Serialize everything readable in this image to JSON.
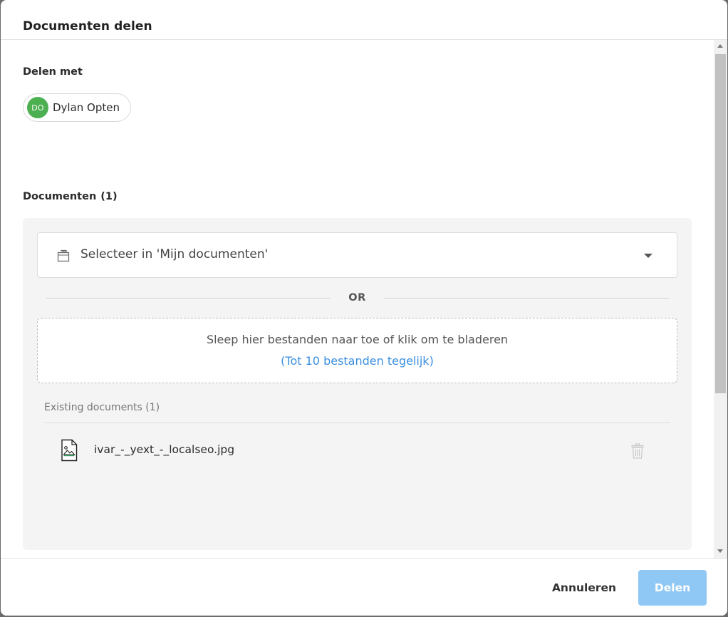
{
  "dialog": {
    "title": "Documenten delen"
  },
  "share_with": {
    "label": "Delen met",
    "recipients": [
      {
        "initials": "DO",
        "name": "Dylan Opten",
        "color": "#4caf50"
      }
    ]
  },
  "documents": {
    "label": "Documenten",
    "count": "(1)",
    "select": {
      "text": "Selecteer in 'Mijn documenten'",
      "icon": "folder-icon"
    },
    "divider_text": "OR",
    "dropzone": {
      "main_text": "Sleep hier bestanden naar toe of klik om te bladeren",
      "sub_text": "(Tot 10 bestanden tegelijk)"
    },
    "existing": {
      "title": "Existing documents (1)",
      "files": [
        {
          "name": "ivar_-_yext_-_localseo.jpg",
          "icon": "image-file-icon"
        }
      ]
    }
  },
  "footer": {
    "cancel_label": "Annuleren",
    "share_label": "Delen"
  },
  "colors": {
    "accent_link": "#3b8fe0",
    "share_button_disabled": "#90c8f5",
    "avatar": "#4caf50"
  }
}
